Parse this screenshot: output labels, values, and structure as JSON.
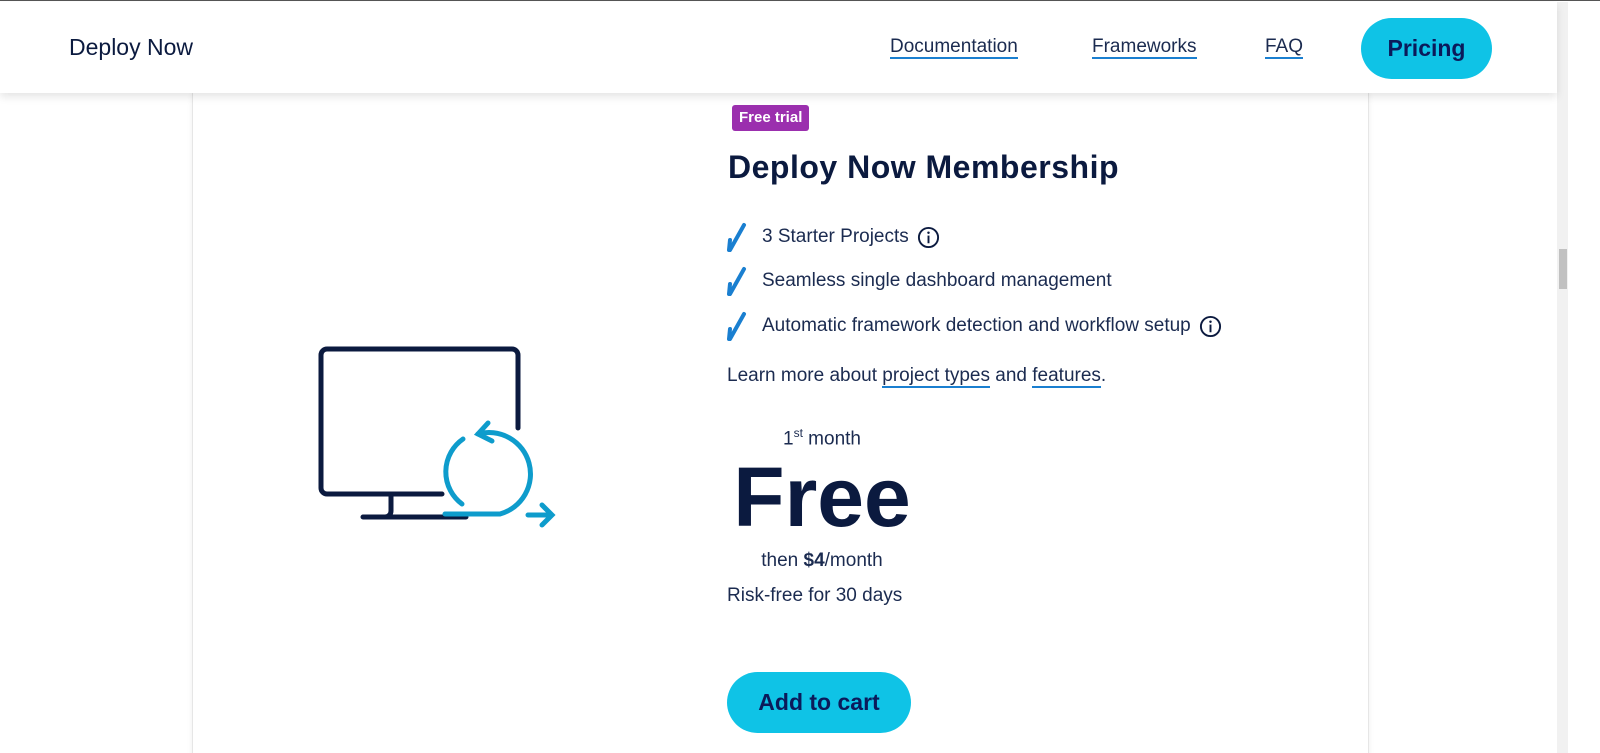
{
  "header": {
    "logo": "Deploy Now",
    "nav": [
      {
        "label": "Documentation"
      },
      {
        "label": "Frameworks"
      },
      {
        "label": "FAQ"
      }
    ],
    "cta": "Pricing"
  },
  "product": {
    "badge": "Free trial",
    "title": "Deploy Now Membership",
    "features": [
      {
        "label": "3 Starter Projects",
        "info": true
      },
      {
        "label": "Seamless single dashboard management",
        "info": false
      },
      {
        "label": "Automatic framework detection and workflow setup",
        "info": true
      }
    ],
    "learn": {
      "prefix": "Learn more about ",
      "link1": "project types",
      "mid": " and ",
      "link2": "features",
      "suffix": "."
    },
    "price": {
      "period_num": "1",
      "period_sup": "st",
      "period_word": " month",
      "main": "Free",
      "then": "then ",
      "amount": "$4",
      "per": "/month"
    },
    "risk": "Risk-free for 30 days",
    "add_to_cart": "Add to cart"
  },
  "colors": {
    "accent": "#0fc3e6",
    "badge": "#9b2fae",
    "navy": "#0b1a3f",
    "check": "#1a7fd0"
  }
}
